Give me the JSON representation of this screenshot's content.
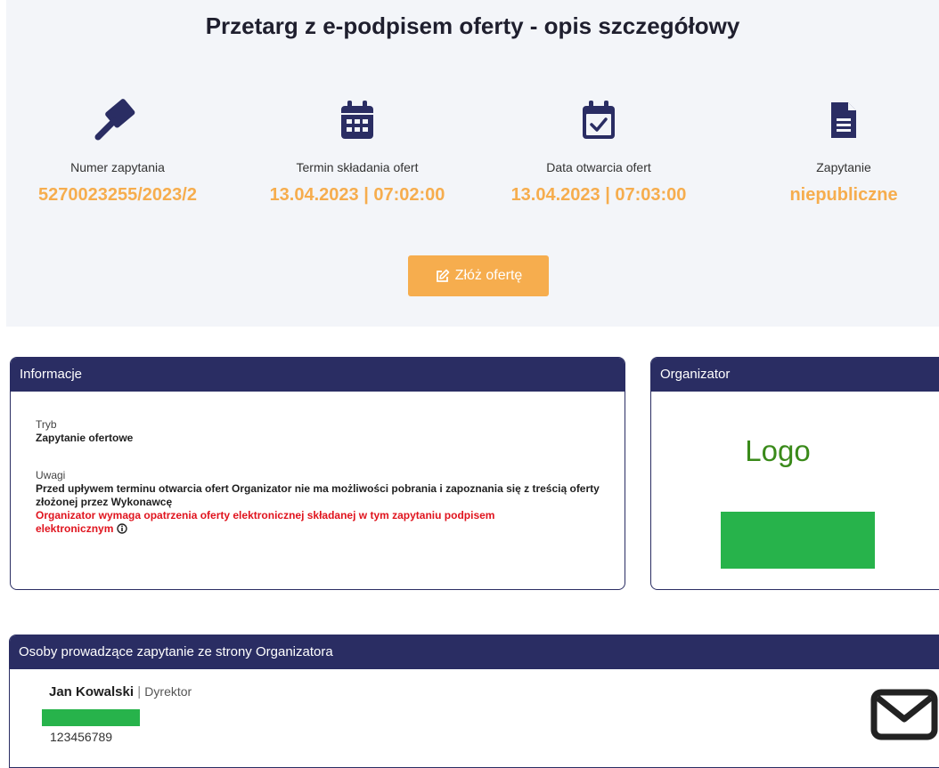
{
  "header": {
    "title": "Przetarg z e-podpisem oferty - opis szczegółowy"
  },
  "stats": [
    {
      "icon": "gavel-icon",
      "label": "Numer zapytania",
      "value": "5270023255/2023/2"
    },
    {
      "icon": "calendar-icon",
      "label": "Termin składania ofert",
      "value": "13.04.2023 | 07:02:00"
    },
    {
      "icon": "calendar-check-icon",
      "label": "Data otwarcia ofert",
      "value": "13.04.2023 | 07:03:00"
    },
    {
      "icon": "document-icon",
      "label": "Zapytanie",
      "value": "niepubliczne"
    }
  ],
  "offer_button": {
    "label": "Złóż ofertę",
    "icon": "edit-icon"
  },
  "info": {
    "title": "Informacje",
    "mode_label": "Tryb",
    "mode_value": "Zapytanie ofertowe",
    "notes_label": "Uwagi",
    "notes_text": "Przed upływem terminu otwarcia ofert Organizator nie ma możliwości pobrania i zapoznania się z treścią oferty złożonej przez Wykonawcę",
    "signature_text": "Organizator wymaga opatrzenia oferty elektronicznej składanej w tym zapytaniu podpisem elektronicznym",
    "signature_icon": "info-icon"
  },
  "organizer": {
    "title": "Organizator",
    "logo_text": "Logo"
  },
  "persons": {
    "title": "Osoby prowadzące zapytanie ze strony Organizatora",
    "name": "Jan Kowalski",
    "separator": "|",
    "role": "Dyrektor",
    "phone": "123456789",
    "contact_icon": "envelope-icon"
  },
  "colors": {
    "accent": "#f6ad4e",
    "header_bg": "#2a2d63",
    "warning": "#e0141e",
    "logo_green": "#3a8a1a",
    "redaction_green": "#27b34b",
    "hero_bg": "#f3f5f9"
  }
}
